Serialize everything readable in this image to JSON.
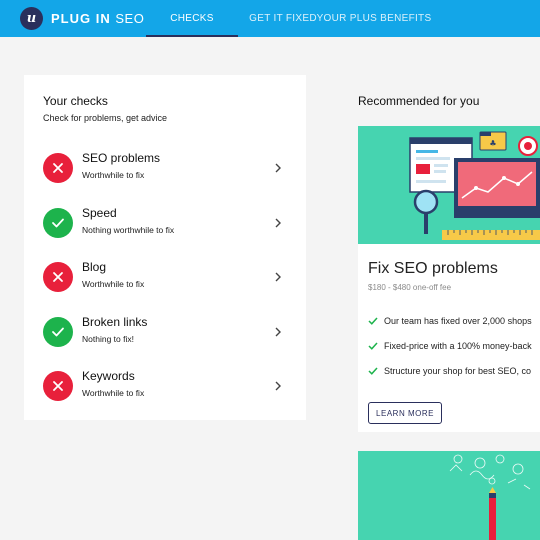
{
  "header": {
    "logo_letter": "u",
    "brand_bold": "PLUG IN",
    "brand_light": "SEO",
    "nav": [
      {
        "label": "CHECKS",
        "active": true
      },
      {
        "label": "GET IT FIXED",
        "active": false
      },
      {
        "label": "YOUR PLUS BENEFITS",
        "active": false
      }
    ],
    "colors": {
      "bar": "#13a6e8",
      "brand_dark": "#2a2f5c"
    }
  },
  "checks": {
    "title": "Your checks",
    "subtitle": "Check for problems, get advice",
    "items": [
      {
        "title": "SEO problems",
        "subtitle": "Worthwhile to fix",
        "status": "fail"
      },
      {
        "title": "Speed",
        "subtitle": "Nothing worthwhile to fix",
        "status": "pass"
      },
      {
        "title": "Blog",
        "subtitle": "Worthwhile to fix",
        "status": "fail"
      },
      {
        "title": "Broken links",
        "subtitle": "Nothing to fix!",
        "status": "pass"
      },
      {
        "title": "Keywords",
        "subtitle": "Worthwhile to fix",
        "status": "fail"
      }
    ],
    "colors": {
      "fail": "#e8203b",
      "pass": "#1db34c"
    }
  },
  "recommended": {
    "title": "Recommended for you",
    "card": {
      "title": "Fix SEO problems",
      "price": "$180 - $480 one-off fee",
      "features": [
        "Our team has fixed over 2,000 shops",
        "Fixed-price with a 100% money-back",
        "Structure your shop for best SEO, co"
      ],
      "button_label": "LEARN MORE",
      "hero_color": "#46d4b0"
    }
  }
}
